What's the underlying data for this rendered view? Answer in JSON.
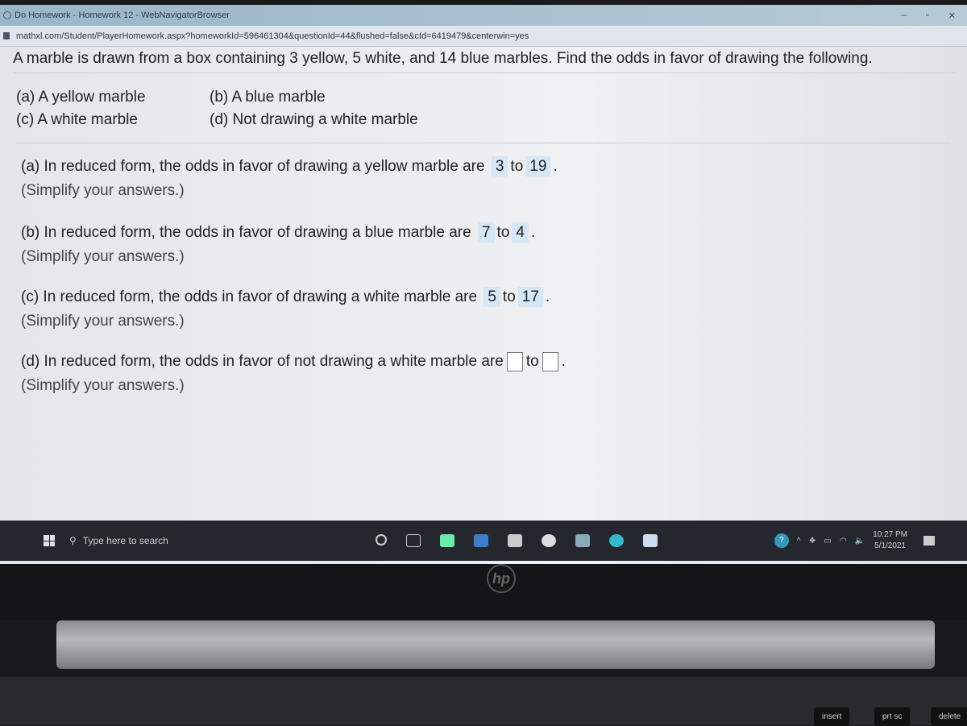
{
  "browser": {
    "title": "Do Homework - Homework 12 - WebNavigatorBrowser",
    "url": "mathxl.com/Student/PlayerHomework.aspx?homeworkId=596461304&questionId=44&flushed=false&cId=6419479&centerwin=yes",
    "minimize": "–",
    "restore": "▫",
    "close": "✕"
  },
  "question": {
    "intro": "A marble is drawn from a box containing 3 yellow, 5 white, and 14 blue marbles. Find the odds in favor of drawing the following.",
    "parts": [
      "(a) A yellow marble",
      "(b) A blue marble",
      "(c) A white marble",
      "(d) Not drawing a white marble"
    ],
    "answers": [
      {
        "text": "(a) In reduced form, the odds in favor of drawing a yellow marble are",
        "a": "3",
        "b": "19"
      },
      {
        "text": "(b) In reduced form, the odds in favor of drawing a blue marble are",
        "a": "7",
        "b": "4"
      },
      {
        "text": "(c) In reduced form, the odds in favor of drawing a white marble are",
        "a": "5",
        "b": "17"
      },
      {
        "text": "(d) In reduced form, the odds in favor of not drawing a white marble are",
        "a": "",
        "b": ""
      }
    ],
    "to": "to",
    "hint": "(Simplify your answers.)"
  },
  "taskbar": {
    "search_placeholder": "Type here to search",
    "time": "10:27 PM",
    "date": "5/1/2021"
  },
  "laptop": {
    "logo": "hp",
    "keys": [
      "insert",
      "prt sc",
      "delete"
    ]
  }
}
